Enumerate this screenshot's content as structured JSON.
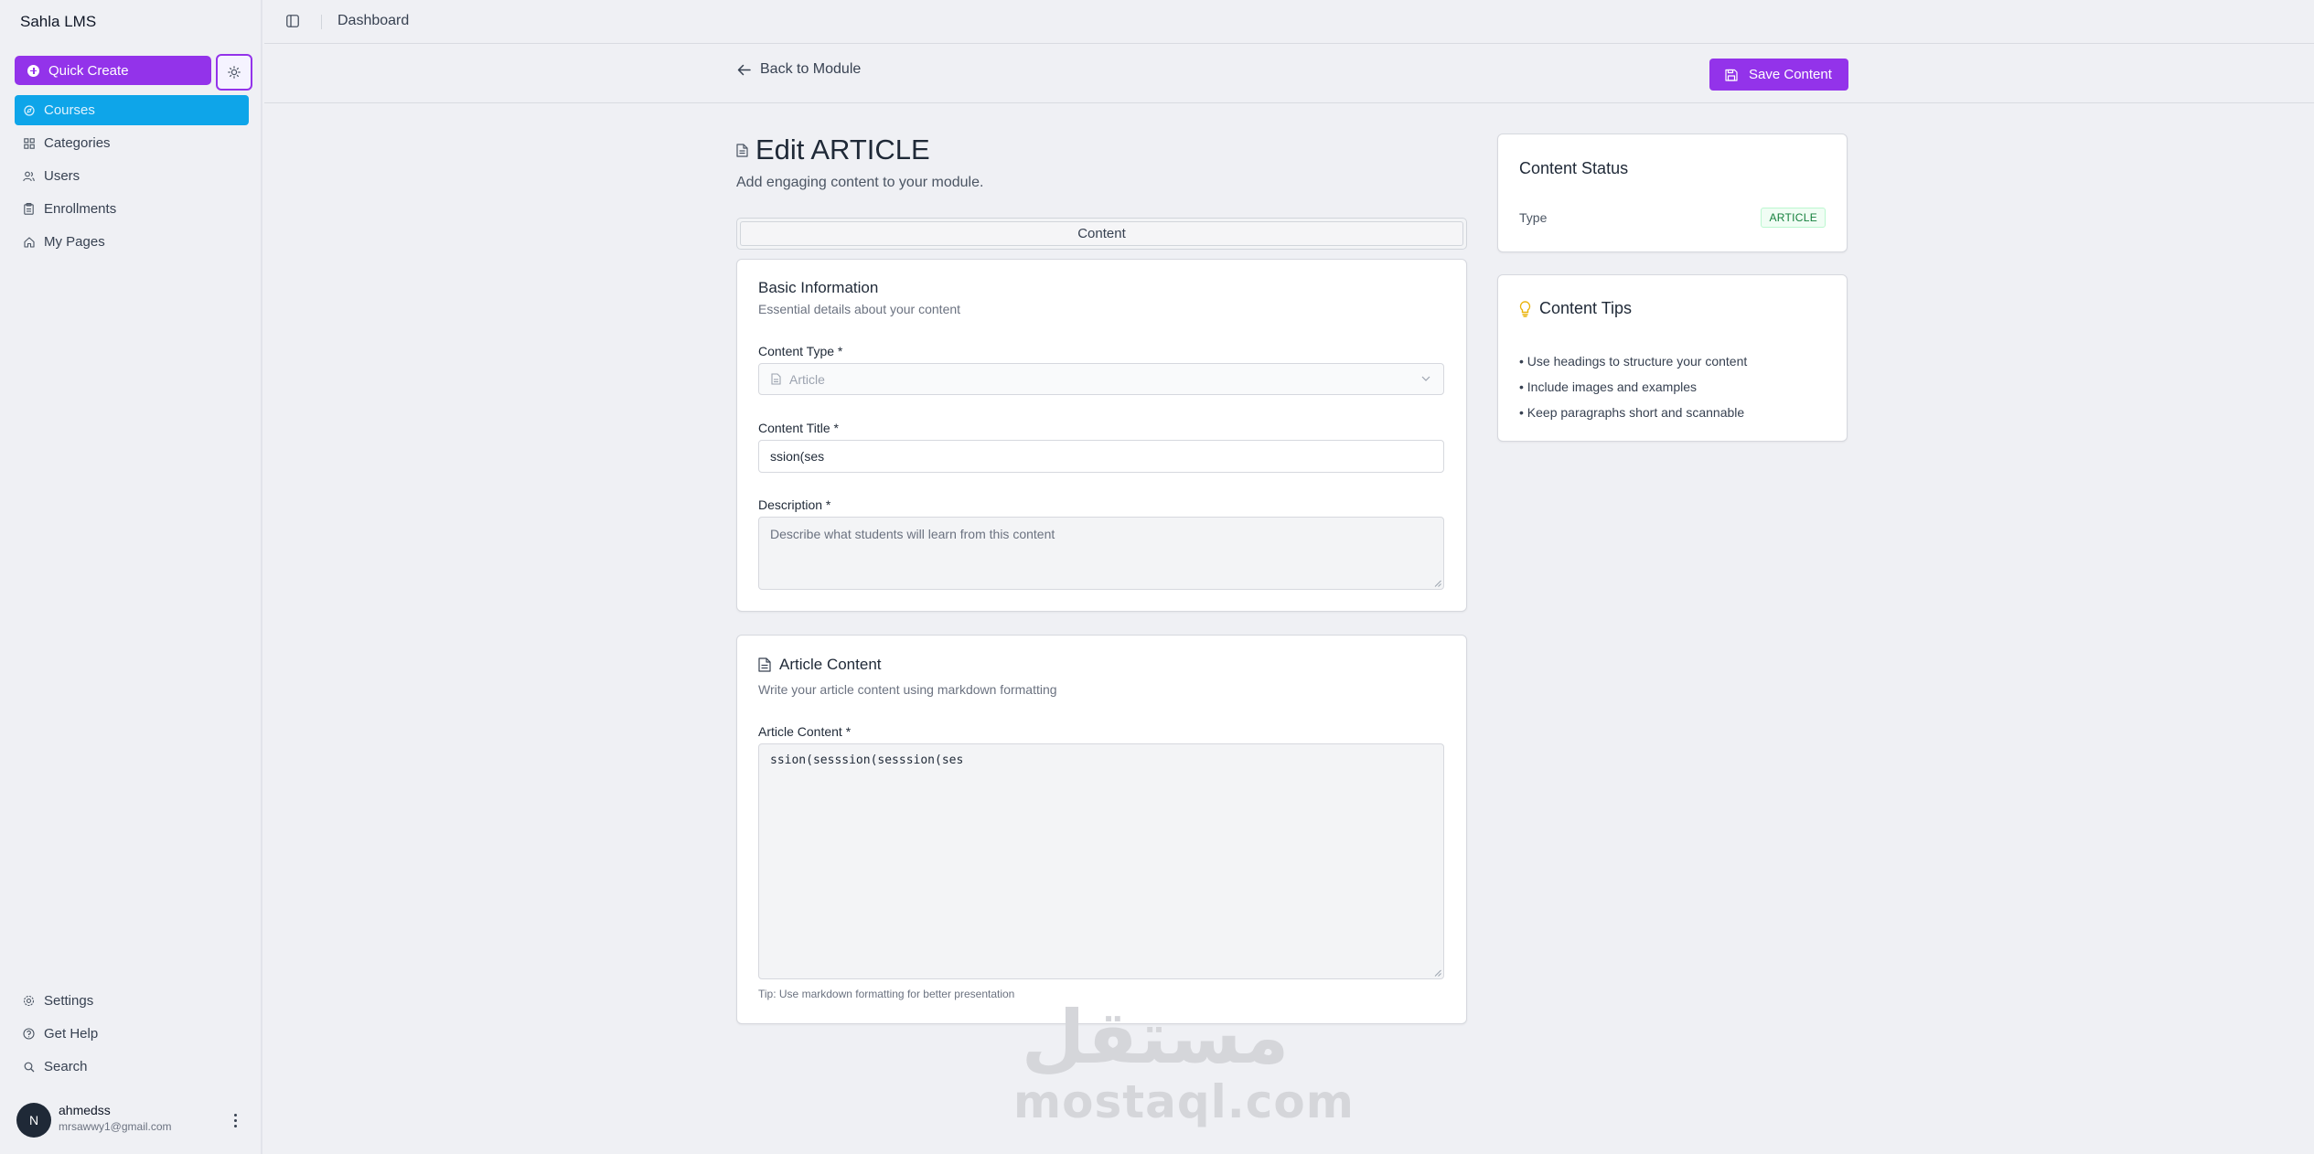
{
  "sidebar": {
    "brand": "Sahla LMS",
    "quick_create": "Quick Create",
    "items": [
      {
        "label": "Courses",
        "icon": "courses-icon",
        "active": true
      },
      {
        "label": "Categories",
        "icon": "grid-icon"
      },
      {
        "label": "Users",
        "icon": "users-icon"
      },
      {
        "label": "Enrollments",
        "icon": "clipboard-icon"
      },
      {
        "label": "My Pages",
        "icon": "home-icon"
      }
    ],
    "bottom_items": [
      {
        "label": "Settings",
        "icon": "gear-icon"
      },
      {
        "label": "Get Help",
        "icon": "help-icon"
      },
      {
        "label": "Search",
        "icon": "search-icon"
      }
    ],
    "user": {
      "initial": "N",
      "name": "ahmedss",
      "email": "mrsawwy1@gmail.com"
    }
  },
  "header": {
    "breadcrumb": "Dashboard"
  },
  "toolbar": {
    "back_label": "Back to Module",
    "save_label": "Save Content"
  },
  "page": {
    "title": "Edit ARTICLE",
    "subtitle": "Add engaging content to your module.",
    "tab": "Content"
  },
  "basic_info": {
    "heading": "Basic Information",
    "sub": "Essential details about your content",
    "type_label": "Content Type *",
    "type_value": "Article",
    "title_label": "Content Title *",
    "title_value": "ssion(ses",
    "desc_label": "Description *",
    "desc_placeholder": "Describe what students will learn from this content"
  },
  "article": {
    "heading": "Article Content",
    "sub": "Write your article content using markdown formatting",
    "label": "Article Content *",
    "value": "ssion(sesssion(sesssion(ses",
    "tip": "Tip: Use markdown formatting for better presentation"
  },
  "status": {
    "heading": "Content Status",
    "type_label": "Type",
    "type_badge": "ARTICLE"
  },
  "tips": {
    "heading": "Content Tips",
    "items": [
      "• Use headings to structure your content",
      "• Include images and examples",
      "• Keep paragraphs short and scannable"
    ]
  },
  "watermark": {
    "arabic": "مستقل",
    "latin": "mostaql.com"
  },
  "colors": {
    "accent": "#9333ea",
    "active_nav": "#0ea5e9",
    "badge_green": "#15803d"
  }
}
